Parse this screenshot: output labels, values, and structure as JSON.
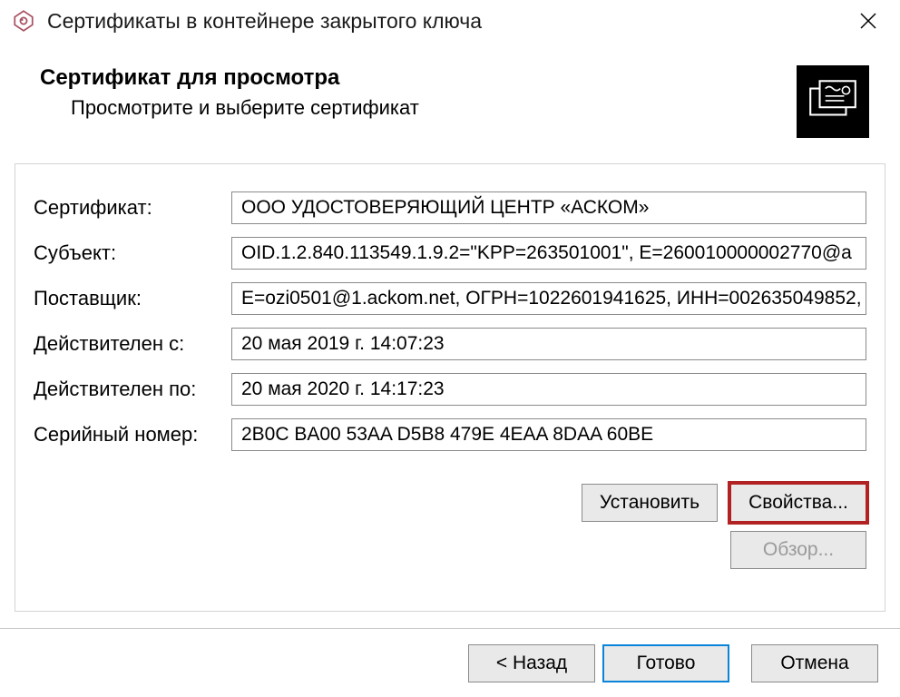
{
  "window": {
    "title": "Сертификаты в контейнере закрытого ключа"
  },
  "header": {
    "title": "Сертификат для просмотра",
    "subtitle": "Просмотрите и выберите сертификат"
  },
  "fields": {
    "certificate": {
      "label": "Сертификат:",
      "value": "ООО УДОСТОВЕРЯЮЩИЙ ЦЕНТР «АСКОМ»"
    },
    "subject": {
      "label": "Субъект:",
      "value": "OID.1.2.840.113549.1.9.2=\"KPP=263501001\", E=260010000002770@a"
    },
    "issuer": {
      "label": "Поставщик:",
      "value": "E=ozi0501@1.ackom.net, ОГРН=1022601941625, ИНН=002635049852,"
    },
    "validFrom": {
      "label": "Действителен с:",
      "value": "20 мая 2019 г. 14:07:23"
    },
    "validTo": {
      "label": "Действителен по:",
      "value": "20 мая 2020 г. 14:17:23"
    },
    "serial": {
      "label": "Серийный номер:",
      "value": "2B0C BA00 53AA D5B8 479E 4EAA 8DAA 60BE"
    }
  },
  "buttons": {
    "install": "Установить",
    "properties": "Свойства...",
    "browse": "Обзор...",
    "back": "< Назад",
    "finish": "Готово",
    "cancel": "Отмена"
  }
}
